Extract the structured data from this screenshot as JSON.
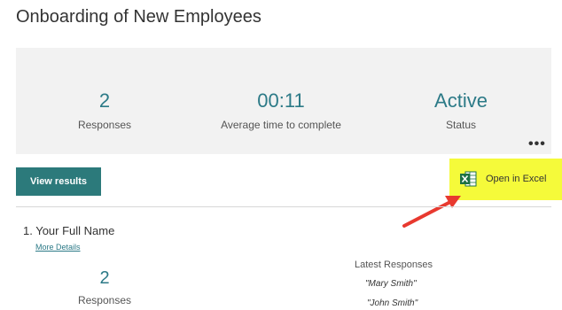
{
  "page_title": "Onboarding of New Employees",
  "summary": {
    "responses": {
      "value": "2",
      "label": "Responses"
    },
    "avg_time": {
      "value": "00:11",
      "label": "Average time to complete"
    },
    "status": {
      "value": "Active",
      "label": "Status"
    },
    "more_options": "•••"
  },
  "actions": {
    "view_results": "View results",
    "open_in_excel": "Open in Excel"
  },
  "question": {
    "title": "1.  Your Full Name",
    "more_details": "More Details",
    "responses_value": "2",
    "responses_label": "Responses",
    "latest_title": "Latest Responses",
    "latest": [
      "\"Mary Smith\"",
      "\"John Smith\""
    ]
  },
  "colors": {
    "accent": "#2c7a87",
    "button": "#2c7a7b",
    "highlight": "#f5fa3a",
    "arrow": "#e8392f",
    "excel_green": "#1e7145"
  }
}
